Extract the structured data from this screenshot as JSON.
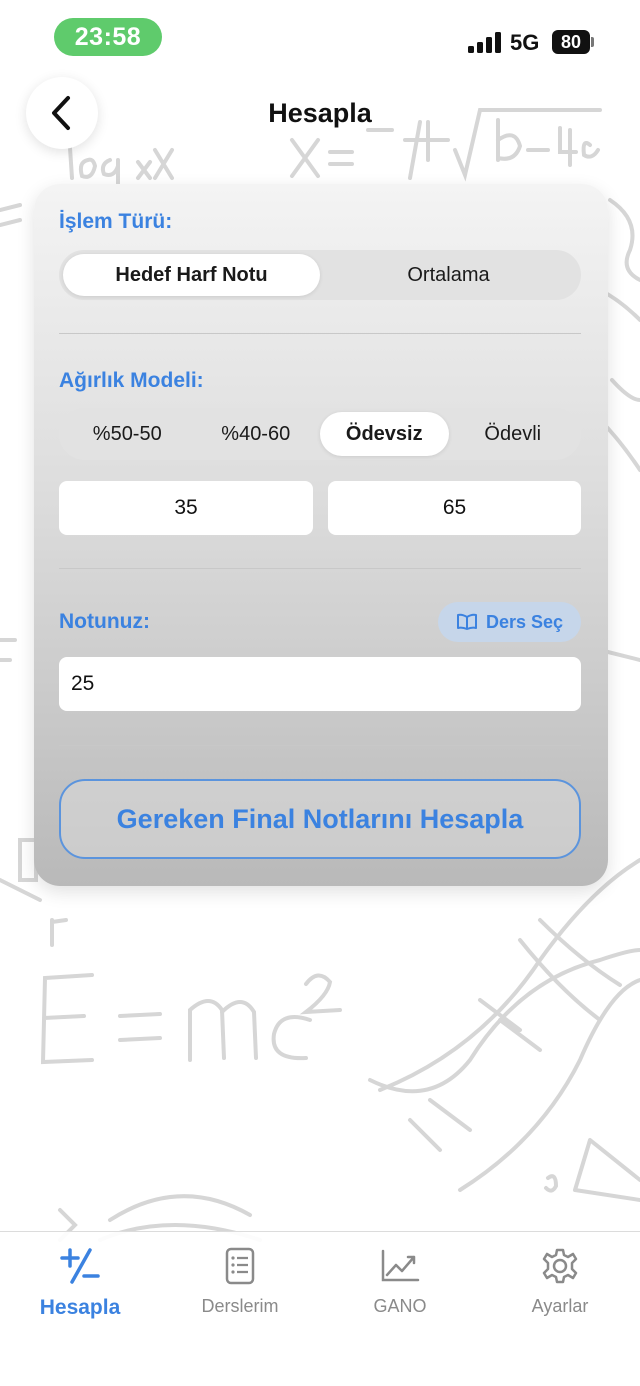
{
  "status_bar": {
    "time": "23:58",
    "network": "5G",
    "battery": "80"
  },
  "nav": {
    "title": "Hesapla"
  },
  "card": {
    "operation_label": "İşlem Türü:",
    "operation_options": [
      "Hedef Harf Notu",
      "Ortalama"
    ],
    "operation_selected": "Hedef Harf Notu",
    "weight_label": "Ağırlık Modeli:",
    "weight_options": [
      "%50-50",
      "%40-60",
      "Ödevsiz",
      "Ödevli"
    ],
    "weight_selected": "Ödevsiz",
    "weight_values": [
      "35",
      "65"
    ],
    "grade_label": "Notunuz:",
    "select_course_label": "Ders Seç",
    "grade_value": "25",
    "calculate_label": "Gereken Final Notlarını Hesapla"
  },
  "tabs": [
    {
      "label": "Hesapla",
      "icon": "plus-minus-icon",
      "active": true
    },
    {
      "label": "Derslerim",
      "icon": "list-document-icon",
      "active": false
    },
    {
      "label": "GANO",
      "icon": "chart-trend-icon",
      "active": false
    },
    {
      "label": "Ayarlar",
      "icon": "gear-icon",
      "active": false
    }
  ],
  "colors": {
    "accent": "#3b82e0",
    "time_pill": "#5fcb6c"
  }
}
